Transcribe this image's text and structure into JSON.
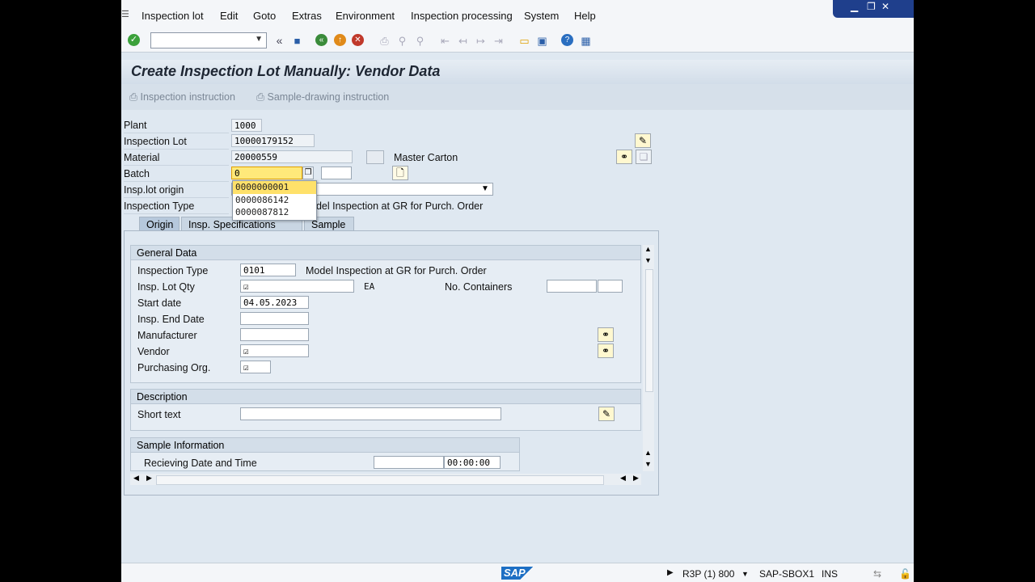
{
  "menu": [
    "Inspection lot",
    "Edit",
    "Goto",
    "Extras",
    "Environment",
    "Inspection processing",
    "System",
    "Help"
  ],
  "title": "Create Inspection Lot Manually: Vendor Data",
  "app_toolbar": {
    "inspection_instruction": "Inspection instruction",
    "sample_drawing_instruction": "Sample-drawing instruction"
  },
  "header": {
    "plant_label": "Plant",
    "plant_value": "1000",
    "inspection_lot_label": "Inspection Lot",
    "inspection_lot_value": "10000179152",
    "material_label": "Material",
    "material_value": "20000559",
    "material_desc": "Master Carton",
    "batch_label": "Batch",
    "batch_value": "0",
    "insp_lot_origin_label": "Insp.lot origin",
    "inspection_type_label": "Inspection Type",
    "inspection_type_desc": "odel Inspection at GR for Purch. Order"
  },
  "batch_dropdown": [
    "0000000001",
    "0000086142",
    "0000087812"
  ],
  "tabs": [
    "Origin",
    "Insp. Specifications",
    "Sample"
  ],
  "general": {
    "header": "General Data",
    "inspection_type_label": "Inspection Type",
    "inspection_type_value": "0101",
    "inspection_type_desc": "Model Inspection at GR for Purch. Order",
    "lot_qty_label": "Insp. Lot Qty",
    "lot_qty_unit": "EA",
    "containers_label": "No. Containers",
    "start_date_label": "Start date",
    "start_date_value": "04.05.2023",
    "end_date_label": "Insp. End Date",
    "manufacturer_label": "Manufacturer",
    "vendor_label": "Vendor",
    "purch_org_label": "Purchasing Org."
  },
  "description": {
    "header": "Description",
    "short_text_label": "Short text"
  },
  "sample": {
    "header": "Sample Information",
    "receiving_label": "Recieving Date and Time",
    "time_value": "00:00:00"
  },
  "status": {
    "system": "R3P (1) 800",
    "server": "SAP-SBOX1",
    "mode": "INS",
    "logo": "SAP"
  },
  "colors": {
    "active_field": "#ffe97a",
    "title_bar": "#1f3f8c",
    "sap_blue": "#1d6fc4"
  }
}
